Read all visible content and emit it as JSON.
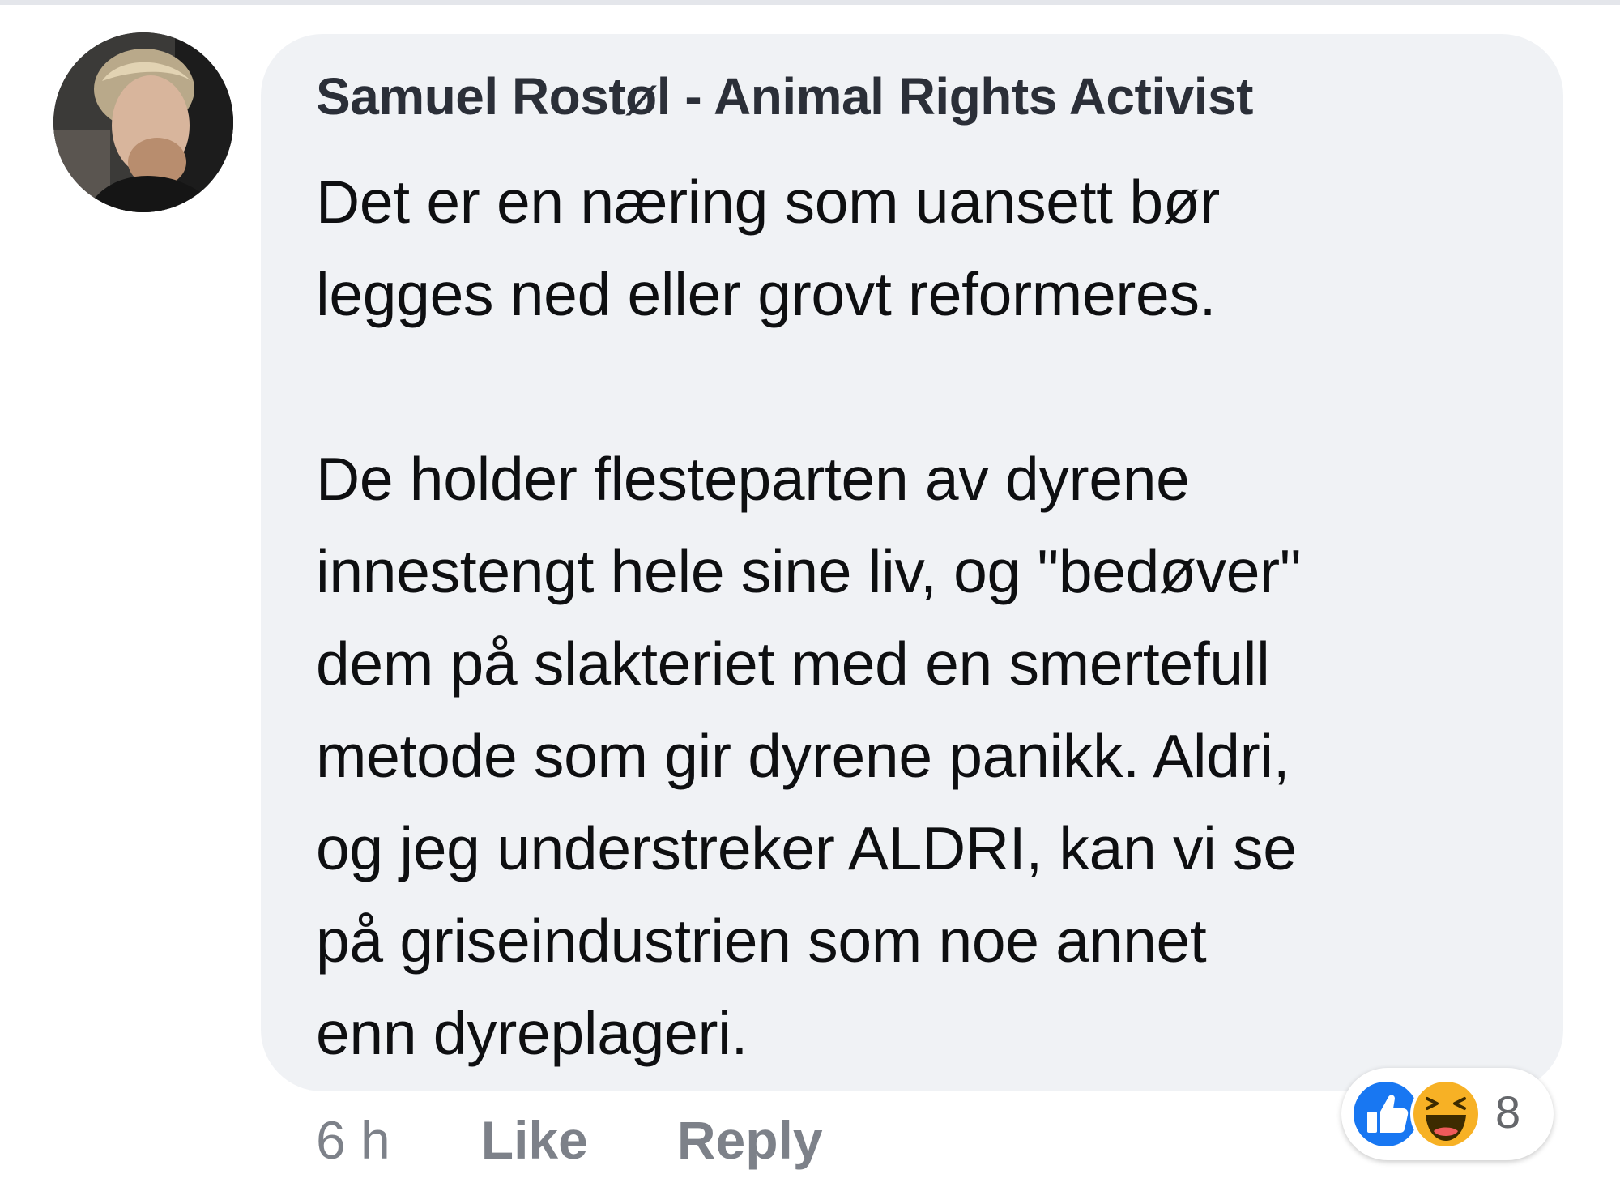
{
  "comment": {
    "author": "Samuel Rostøl - Animal Rights Activist",
    "paragraphs": [
      [
        "Det er en næring som uansett bør",
        "legges ned eller grovt reformeres."
      ],
      [
        "De holder flesteparten av dyrene",
        "innestengt hele sine liv, og \"bedøver\"",
        "dem på slakteriet med en smertefull",
        "metode som gir dyrene panikk. Aldri,",
        "og jeg understreker ALDRI, kan vi se",
        "på griseindustrien som noe annet",
        "enn dyreplageri."
      ]
    ],
    "timestamp": "6 h",
    "like_label": "Like",
    "reply_label": "Reply",
    "reaction_count": "8",
    "reaction_icons": [
      "like-icon",
      "haha-icon"
    ]
  },
  "colors": {
    "bubble": "#f0f2f5",
    "author_text": "#2b2f38",
    "body_text": "#0e0f11",
    "action_text": "#7d8189",
    "like_blue": "#1877f2",
    "haha_yellow": "#f7b125"
  }
}
